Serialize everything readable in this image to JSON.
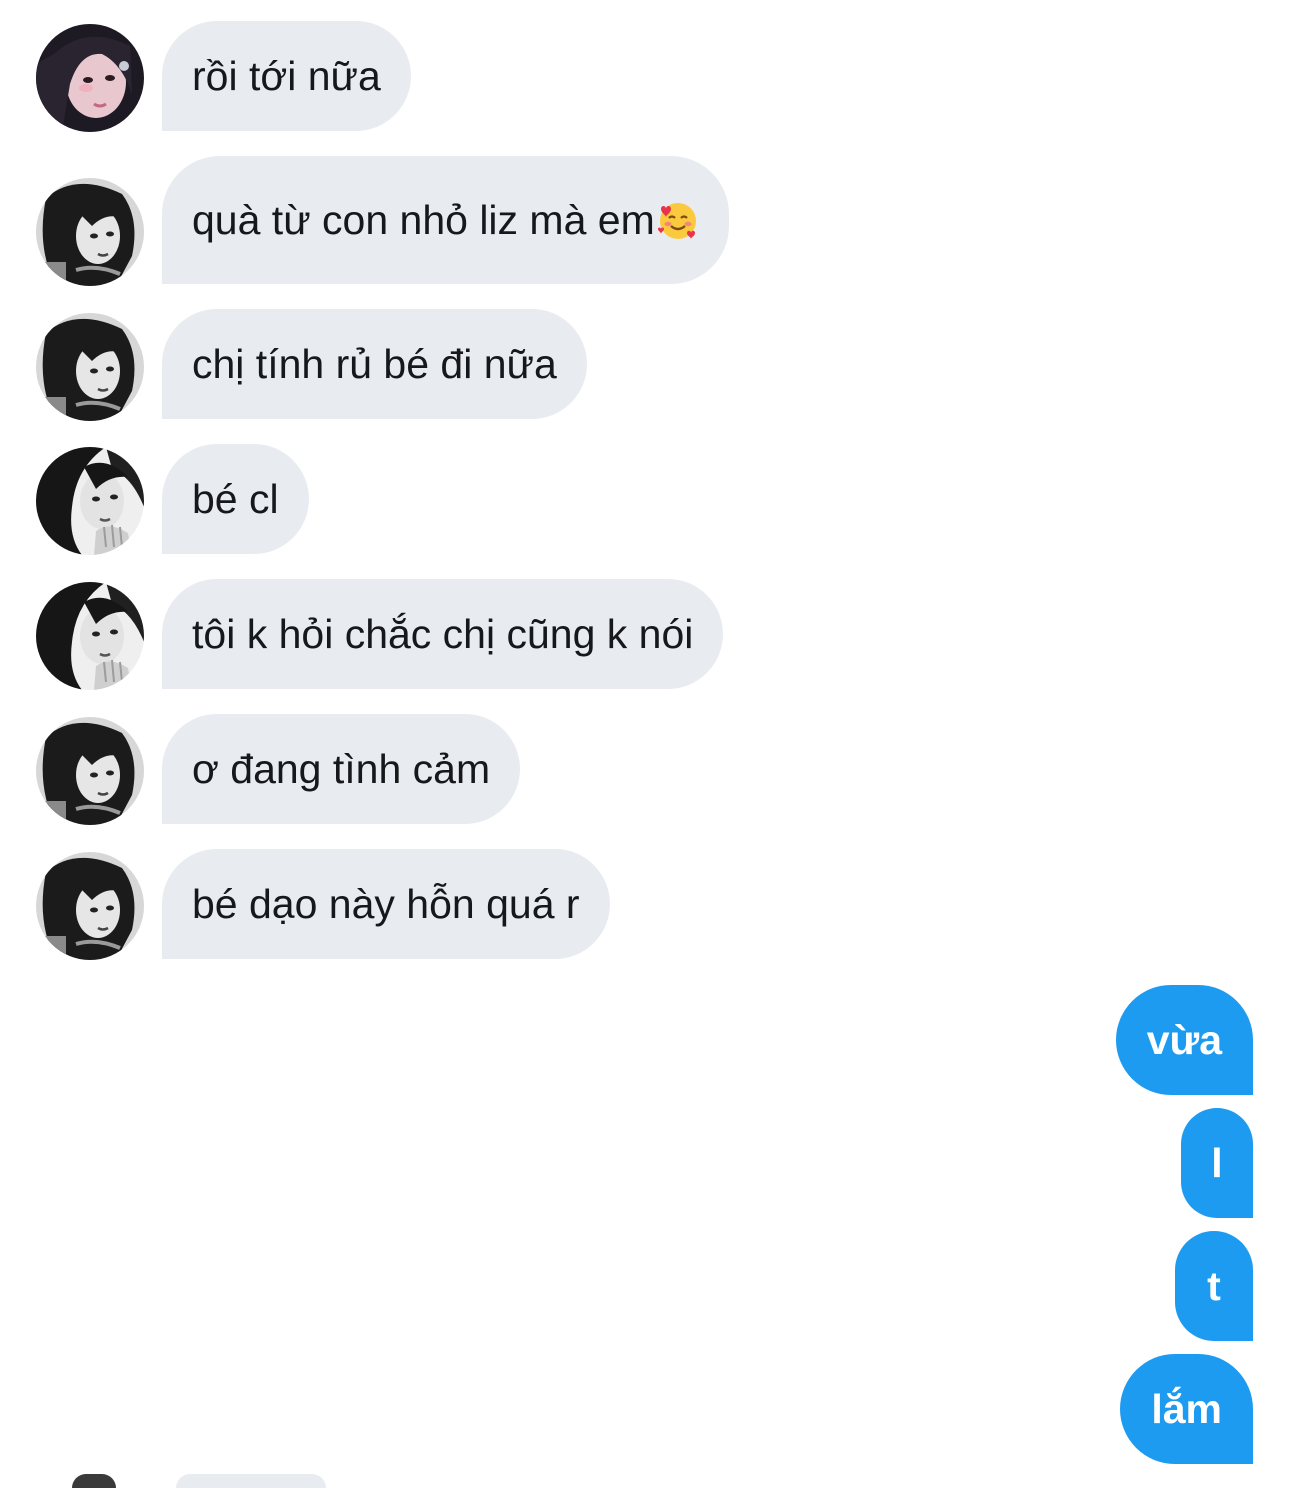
{
  "conversation": {
    "messages": [
      {
        "sender": "them",
        "avatar": "avatar-pink-hair-icon",
        "text": "rồi tới nữa"
      },
      {
        "sender": "them",
        "avatar": "avatar-bw-curly-icon",
        "text": "quà từ con nhỏ liz mà em",
        "emoji": "smiling-face-with-hearts-icon"
      },
      {
        "sender": "them",
        "avatar": "avatar-bw-curly-icon",
        "text": "chị tính rủ bé đi nữa"
      },
      {
        "sender": "them",
        "avatar": "avatar-bw-hand-icon",
        "text": "bé cl"
      },
      {
        "sender": "them",
        "avatar": "avatar-bw-hand-icon",
        "text": "tôi k hỏi chắc chị cũng k nói"
      },
      {
        "sender": "them",
        "avatar": "avatar-bw-curly-icon",
        "text": "ơ đang tình cảm"
      },
      {
        "sender": "them",
        "avatar": "avatar-bw-curly-icon",
        "text": "bé dạo này hỗn quá r"
      },
      {
        "sender": "me",
        "text": "vừa"
      },
      {
        "sender": "me",
        "text": "l"
      },
      {
        "sender": "me",
        "text": "t"
      },
      {
        "sender": "me",
        "text": "lắm"
      }
    ]
  },
  "colors": {
    "incoming_bubble": "#e8ecf0",
    "outgoing_bubble": "#1d9bf0",
    "incoming_text": "#17181b",
    "outgoing_text": "#ffffff",
    "background": "#ffffff"
  }
}
